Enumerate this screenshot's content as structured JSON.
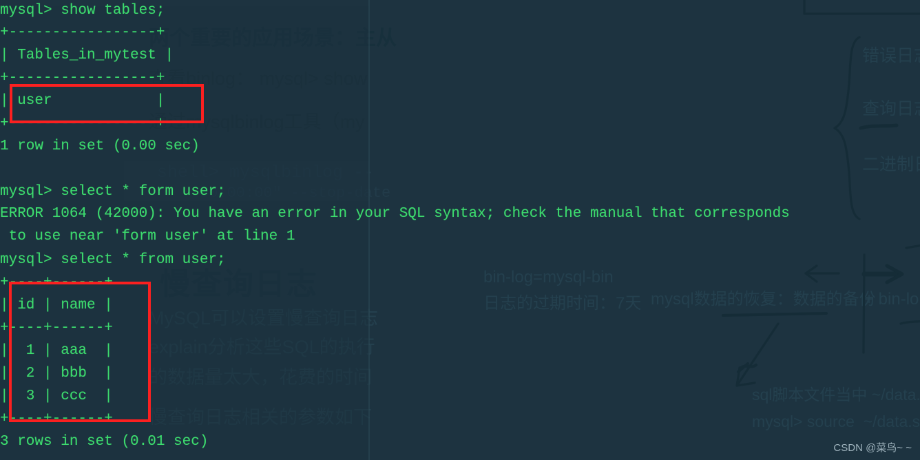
{
  "meta": {
    "colors": {
      "background": "#1d3340",
      "terminal_text": "#3ddc6e",
      "annotation_red": "#fb2020",
      "faded_note": "#24404e",
      "watermark": "#9fb3bd"
    }
  },
  "terminal": {
    "lines": [
      "mysql> show tables;",
      "+-----------------+",
      "| Tables_in_mytest |",
      "+-----------------+",
      "| user            |",
      "+-----------------+",
      "1 row in set (0.00 sec)",
      "mysql> select * form user;",
      "ERROR 1064 (42000): You have an error in your SQL syntax; check the manual that corresponds",
      " to use near 'form user' at line 1",
      "mysql> select * from user;",
      "+----+------+",
      "| id | name |",
      "+----+------+",
      "|  1 | aaa  |",
      "|  2 | bbb  |",
      "|  3 | ccc  |",
      "+----+------+",
      "3 rows in set (0.01 sec)"
    ],
    "prompt": "mysql>",
    "commands": [
      "show tables;",
      "select * form user;",
      "select * from user;"
    ],
    "result_table_tables": {
      "header": "Tables_in_mytest",
      "rows": [
        "user"
      ],
      "footer": "1 row in set (0.00 sec)"
    },
    "result_table_user": {
      "headers": [
        "id",
        "name"
      ],
      "rows": [
        [
          "1",
          "aaa"
        ],
        [
          "2",
          "bbb"
        ],
        [
          "3",
          "ccc"
        ]
      ],
      "footer": "3 rows in set (0.01 sec)"
    },
    "error": {
      "code": "ERROR 1064 (42000)",
      "message_line1": "ERROR 1064 (42000): You have an error in your SQL syntax; check the manual that corresponds",
      "message_line2": " to use near 'form user' at line 1"
    }
  },
  "annotations": {
    "box_user_label": "user-row-highlight",
    "box_result_label": "result-table-highlight"
  },
  "background_notes": {
    "slide_title": "慢查询日志",
    "lines": [
      "两个重要的应用场景：主从",
      "查看binlog： mysql> show",
      "通过mysqlbinlog工具（my",
      "shell> mysqlbinlog --",
      "00:00:00\" --stop-date",
      "MySQL可以设置慢查询日志",
      "explain分析这些SQL的执行",
      "的数据量太大，花费的时间",
      "慢查询日志相关的参数如下"
    ],
    "right_notes": [
      "错误日志",
      "查询日志",
      "二进制日",
      "bin-log=mysql-bin",
      "日志的过期时间：7天",
      "mysql数据的恢复：数据的备份",
      "+ bin-lo",
      "sql脚本文件当中 ~/data.s",
      "mysql> source  ~/data.s"
    ]
  },
  "watermark": {
    "text": "CSDN @菜鸟~ ~"
  }
}
